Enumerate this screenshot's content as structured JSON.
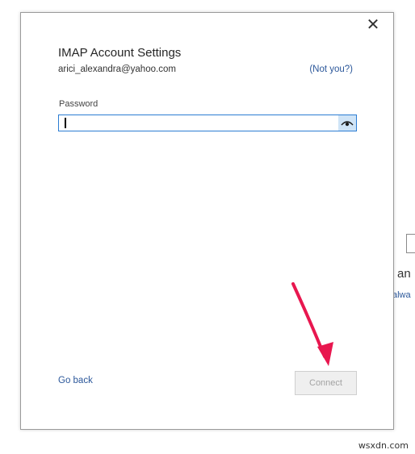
{
  "dialog": {
    "title": "IMAP Account Settings",
    "email": "arici_alexandra@yahoo.com",
    "not_you_link": "(Not you?)",
    "close_icon": "close-icon",
    "password": {
      "label": "Password",
      "value": "",
      "reveal_icon": "eye-icon"
    },
    "go_back_link": "Go back",
    "connect_button": "Connect"
  },
  "background": {
    "partial_text": "an",
    "partial_link": "alwa"
  },
  "watermark": "wsxdn.com",
  "colors": {
    "link": "#2b579a",
    "input_border": "#2b7cd3",
    "eye_button_bg": "#cfe4f7",
    "arrow": "#e8174f",
    "disabled_button_text": "#a3a3a3"
  }
}
